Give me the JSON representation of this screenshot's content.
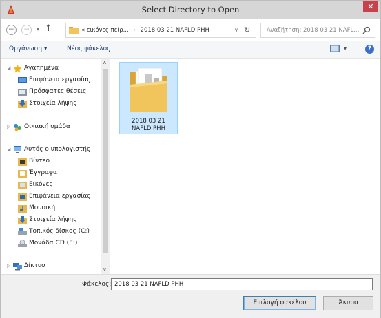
{
  "window": {
    "title": "Select Directory to Open",
    "close_glyph": "✕"
  },
  "address_bar": {
    "prefix": "«",
    "crumbs": [
      "εικόνες πείρ...",
      "2018 03 21 NAFLD PHH"
    ],
    "search_placeholder": "Αναζήτηση: 2018 03 21 NAFL..."
  },
  "toolbar": {
    "organize_label": "Οργάνωση ▾",
    "new_folder_label": "Νέος φάκελος",
    "help_glyph": "?"
  },
  "nav_pane": {
    "favorites": {
      "label": "Αγαπημένα",
      "items": [
        "Επιφάνεια εργασίας",
        "Πρόσφατες θέσεις",
        "Στοιχεία λήψης"
      ]
    },
    "homegroup": {
      "label": "Οικιακή ομάδα"
    },
    "computer": {
      "label": "Αυτός ο υπολογιστής",
      "items": [
        "Βίντεο",
        "Έγγραφα",
        "Εικόνες",
        "Επιφάνεια εργασίας",
        "Μουσική",
        "Στοιχεία λήψης",
        "Τοπικός δίσκος (C:)",
        "Μονάδα CD (E:)"
      ]
    },
    "network": {
      "label": "Δίκτυο"
    }
  },
  "content": {
    "folders": [
      {
        "name_line1": "2018 03 21",
        "name_line2": "NAFLD PHH"
      }
    ]
  },
  "footer": {
    "folder_label": "Φάκελος:",
    "folder_value": "2018 03 21 NAFLD PHH",
    "select_button": "Επιλογή φακέλου",
    "cancel_button": "Άκυρο"
  },
  "colors": {
    "title_bar": "#d6d6d6",
    "close_button": "#c7424a",
    "selection": "#cce8ff",
    "link_text": "#1c3f6e"
  }
}
